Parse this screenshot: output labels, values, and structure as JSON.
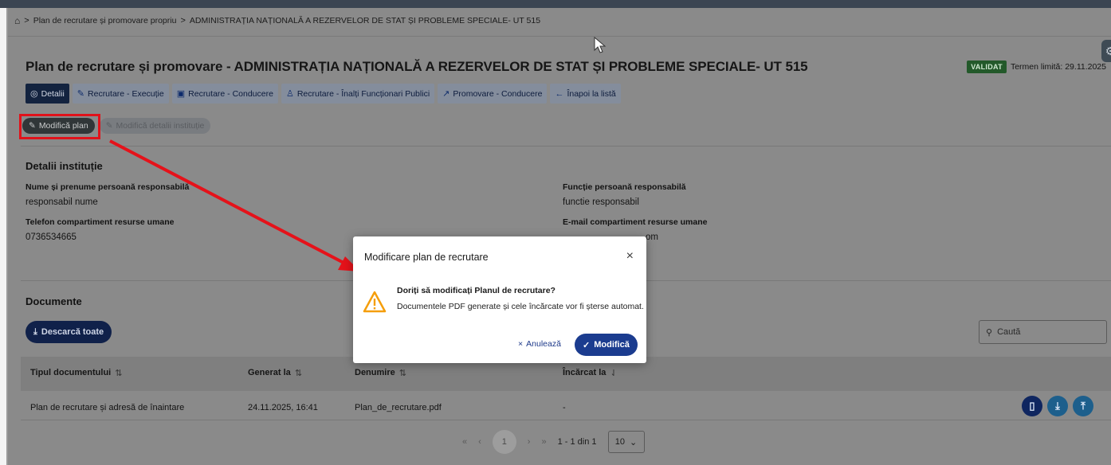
{
  "breadcrumb": {
    "items": [
      "Plan de recrutare și promovare propriu",
      "ADMINISTRAȚIA NAȚIONALĂ A REZERVELOR DE STAT ȘI PROBLEME SPECIALE- UT 515"
    ],
    "separator": ">"
  },
  "header": {
    "title": "Plan de recrutare și promovare - ADMINISTRAȚIA NAȚIONALĂ A REZERVELOR DE STAT ȘI PROBLEME SPECIALE- UT 515",
    "status_badge": "VALIDAT",
    "deadline": "Termen limită: 29.11.2025"
  },
  "tabs": [
    {
      "label": "Detalii",
      "icon": "eye-icon",
      "active": true
    },
    {
      "label": "Recrutare - Execuție",
      "icon": "pen-icon",
      "active": false
    },
    {
      "label": "Recrutare - Conducere",
      "icon": "briefcase-icon",
      "active": false
    },
    {
      "label": "Recrutare - Înalți Funcționari Publici",
      "icon": "user-icon",
      "active": false
    },
    {
      "label": "Promovare - Conducere",
      "icon": "trend-icon",
      "active": false
    },
    {
      "label": "Înapoi la listă",
      "icon": "arrow-left-icon",
      "active": false
    }
  ],
  "actions": {
    "modify_plan": "Modifică plan",
    "modify_institution": "Modifică detalii instituție"
  },
  "institution": {
    "heading": "Detalii instituție",
    "responsible_name_label": "Nume și prenume persoană responsabilă",
    "responsible_name_value": "responsabil nume",
    "responsible_function_label": "Funcție persoană responsabilă",
    "responsible_function_value": "functie responsabil",
    "hr_phone_label": "Telefon compartiment resurse umane",
    "hr_phone_value": "0736534665",
    "hr_email_label": "E-mail compartiment resurse umane",
    "hr_email_value": "om"
  },
  "documents": {
    "heading": "Documente",
    "download_all": "Descarcă toate",
    "search_placeholder": "Caută",
    "columns": [
      "Tipul documentului",
      "Generat la",
      "Denumire",
      "Încărcat la"
    ],
    "rows": [
      {
        "type": "Plan de recrutare și adresă de înaintare",
        "generated": "24.11.2025, 16:41",
        "name": "Plan_de_recrutare.pdf",
        "uploaded": "-"
      }
    ]
  },
  "pagination": {
    "first": "«",
    "prev": "‹",
    "current": "1",
    "next": "›",
    "last": "»",
    "info": "1 - 1 din 1",
    "page_size": "10"
  },
  "modal": {
    "title": "Modificare plan de recrutare",
    "question": "Doriți să modificați Planul de recrutare?",
    "message": "Documentele PDF generate și cele încărcate vor fi șterse automat.",
    "cancel": "Anulează",
    "confirm": "Modifică"
  },
  "colors": {
    "accent": "#1b3c8f",
    "highlight": "#e1121a",
    "badge": "#2e7d32",
    "warning": "#f59e0b"
  }
}
